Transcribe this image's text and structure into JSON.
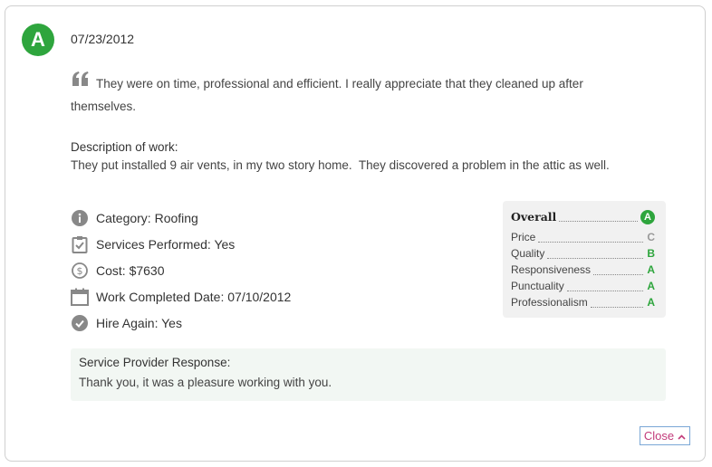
{
  "review": {
    "grade": "A",
    "date": "07/23/2012",
    "quote": "They were on time, professional and efficient. I really appreciate that they cleaned up after themselves.",
    "description_label": "Description of work:",
    "description_text": "They put installed 9 air vents, in my two story home.  They discovered a problem in the attic as well."
  },
  "details": [
    {
      "icon": "info-icon",
      "text": "Category: Roofing"
    },
    {
      "icon": "clipboard-check-icon",
      "text": "Services Performed: Yes"
    },
    {
      "icon": "dollar-icon",
      "text": "Cost: $7630"
    },
    {
      "icon": "calendar-icon",
      "text": "Work Completed Date: 07/10/2012"
    },
    {
      "icon": "check-circle-icon",
      "text": "Hire Again: Yes"
    }
  ],
  "ratings": {
    "overall_label": "Overall",
    "overall_grade": "A",
    "items": [
      {
        "label": "Price",
        "grade": "C",
        "color": "#999999"
      },
      {
        "label": "Quality",
        "grade": "B",
        "color": "#2ea53d"
      },
      {
        "label": "Responsiveness",
        "grade": "A",
        "color": "#2ea53d"
      },
      {
        "label": "Punctuality",
        "grade": "A",
        "color": "#2ea53d"
      },
      {
        "label": "Professionalism",
        "grade": "A",
        "color": "#2ea53d"
      }
    ]
  },
  "response": {
    "label": "Service Provider Response:",
    "text": "Thank you, it was a pleasure working with you."
  },
  "close_label": "Close",
  "colors": {
    "accent_green": "#2ea53d",
    "close_text": "#c23b7a",
    "icon_gray": "#888888"
  }
}
